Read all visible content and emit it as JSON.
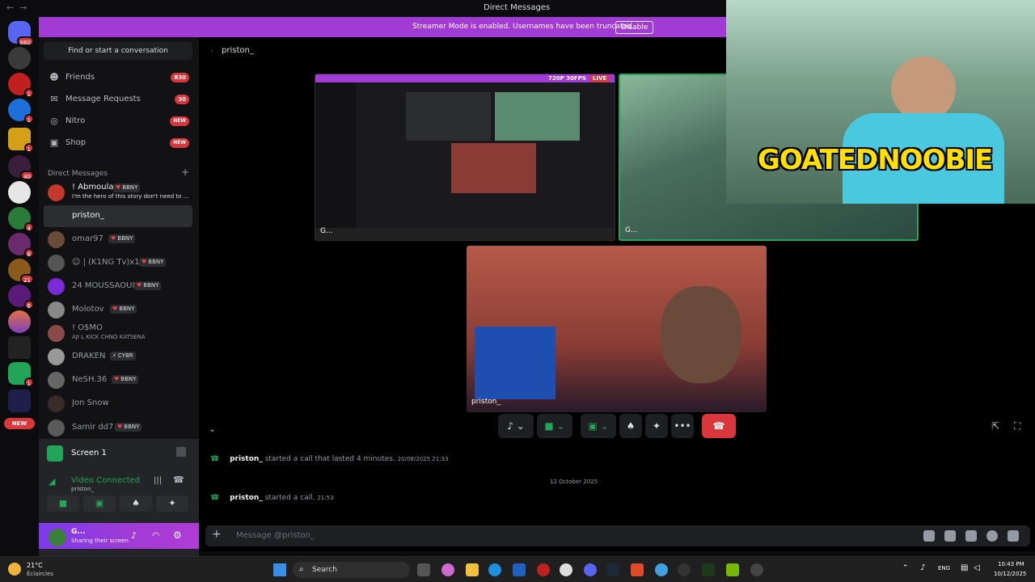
{
  "window": {
    "title": "Direct Messages"
  },
  "banner": {
    "text": "Streamer Mode is enabled. Usernames have been truncated.",
    "button": "Disable"
  },
  "rail": {
    "badges": {
      "home": "860",
      "s2": "1",
      "s3": "1",
      "s4": "1",
      "s5": "40",
      "s6": "1",
      "s7": "4",
      "s8": "8",
      "s9": "21",
      "s10": "6",
      "s11": "1",
      "new": "NEW"
    }
  },
  "sidebar": {
    "search": "Find or start a conversation",
    "nav": [
      {
        "label": "Friends",
        "count": "830"
      },
      {
        "label": "Message Requests",
        "count": "30"
      },
      {
        "label": "Nitro",
        "badge": "NEW"
      },
      {
        "label": "Shop",
        "badge": "NEW"
      }
    ],
    "dm_header": "Direct Messages",
    "dms": [
      {
        "name": "! Abmoula",
        "tag": "BBNY",
        "sub": "I'm the hero of this story don't need to ..."
      },
      {
        "name": "priston_"
      },
      {
        "name": "omar97",
        "tag": "BBNY"
      },
      {
        "name": "☺ | (K1NG Tv)x114",
        "tag": "BBNY"
      },
      {
        "name": "24 MOUSSAOUI",
        "tag": "BBNY"
      },
      {
        "name": "Molotov",
        "tag": "BBNY"
      },
      {
        "name": "! O$MO",
        "sub": "AJI L KICK CHNO KATSENA"
      },
      {
        "name": "DRAKEN",
        "tag": "CYBR"
      },
      {
        "name": "NeSH.36",
        "tag": "BBNY"
      },
      {
        "name": "Jon Snow"
      },
      {
        "name": "Samir dd7",
        "tag": "BBNY"
      }
    ]
  },
  "voice_panel": {
    "screen_label": "Screen 1",
    "status": "Video Connected",
    "channel": "priston_",
    "user_name": "G...",
    "user_sub": "Sharing their screen"
  },
  "call": {
    "channel_name": "priston_",
    "screen_quality": "720P 30FPS",
    "live": "LIVE",
    "screen_label": "G...",
    "streamer_label": "G...",
    "priston_label": "priston_",
    "overlay_text": "GOATEDNOOBIE"
  },
  "messages": [
    {
      "who": "priston_",
      "text": "started a call that lasted 4 minutes.",
      "time": "20/08/2025 21:33"
    },
    {
      "who": "priston_",
      "text": "started a call.",
      "time": "21:53"
    }
  ],
  "date_divider": "12 October 2025",
  "composer": {
    "placeholder": "Message @priston_"
  },
  "taskbar": {
    "temp": "21°C",
    "weather": "Éclaircies",
    "search": "Search",
    "lang": "ENG",
    "time": "10:43 PM",
    "date": "10/12/2025"
  },
  "colors": {
    "accent": "#a23bd6",
    "green": "#23a559",
    "red": "#da373c"
  }
}
